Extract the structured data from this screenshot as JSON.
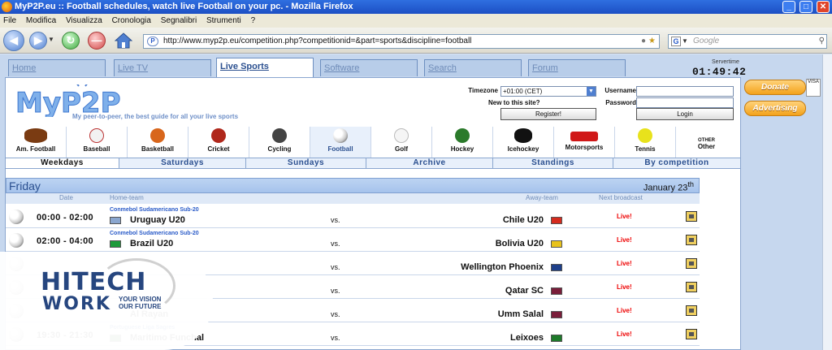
{
  "window": {
    "title": "MyP2P.eu :: Football schedules, watch live Football on your pc. - Mozilla Firefox",
    "min": "_",
    "max": "□",
    "close": "✕"
  },
  "menu": [
    "File",
    "Modifica",
    "Visualizza",
    "Cronologia",
    "Segnalibri",
    "Strumenti",
    "?"
  ],
  "url": "http://www.myp2p.eu/competition.php?competitionid=&part=sports&discipline=football",
  "search_placeholder": "Google",
  "tabs": [
    {
      "label": "Home"
    },
    {
      "label": "Live TV"
    },
    {
      "label": "Live Sports"
    },
    {
      "label": "Software"
    },
    {
      "label": "Search"
    },
    {
      "label": "Forum"
    }
  ],
  "server": {
    "label": "Servertime",
    "time": "01:49:42"
  },
  "logo": {
    "text": "MyP2P",
    "tagline": "My peer-to-peer, the best guide for all your live sports"
  },
  "login": {
    "timezone_label": "Timezone",
    "timezone_value": "+01:00 (CET)",
    "new_label": "New to this site?",
    "register": "Register!",
    "username_label": "Username",
    "password_label": "Password",
    "login": "Login"
  },
  "sports": [
    {
      "label": "Am. Football",
      "color": "#7a3b12"
    },
    {
      "label": "Baseball",
      "color": "#f2f2f2"
    },
    {
      "label": "Basketball",
      "color": "#d8661c"
    },
    {
      "label": "Cricket",
      "color": "#b0281c"
    },
    {
      "label": "Cycling",
      "color": "#444444"
    },
    {
      "label": "Football",
      "color": "#222222"
    },
    {
      "label": "Golf",
      "color": "#f5f5f5"
    },
    {
      "label": "Hockey",
      "color": "#2b7a2b"
    },
    {
      "label": "Icehockey",
      "color": "#111111"
    },
    {
      "label": "Motorsports",
      "color": "#d01818"
    },
    {
      "label": "Tennis",
      "color": "#e8e21c"
    },
    {
      "label": "OTHER",
      "label2": "Other",
      "color": ""
    }
  ],
  "categories": [
    "Weekdays",
    "Saturdays",
    "Sundays",
    "Archive",
    "Standings",
    "By competition"
  ],
  "schedule": {
    "day": "Friday",
    "date": "January 23",
    "date_sup": "th",
    "columns": {
      "date": "Date",
      "home": "Home-team",
      "away": "Away-team",
      "next": "Next broadcast"
    },
    "rows": [
      {
        "time": "00:00 - 02:00",
        "league": "Conmebol Sudamericano Sub-20",
        "home": "Uruguay U20",
        "vs": "vs.",
        "away": "Chile U20",
        "live": "Live!",
        "hflag": "#8aa6cf",
        "aflag": "#d52b1e"
      },
      {
        "time": "02:00 - 04:00",
        "league": "Conmebol Sudamericano Sub-20",
        "home": "Brazil U20",
        "vs": "vs.",
        "away": "Bolivia U20",
        "live": "Live!",
        "hflag": "#1e9a3a",
        "aflag": "#e8c21c"
      },
      {
        "time": "",
        "league": "",
        "home": "",
        "vs": "vs.",
        "away": "Wellington Phoenix",
        "live": "Live!",
        "hflag": "",
        "aflag": "#1e3f8a"
      },
      {
        "time": "",
        "league": "",
        "home": "",
        "vs": "vs.",
        "away": "Qatar SC",
        "live": "Live!",
        "hflag": "",
        "aflag": "#7a1e3a"
      },
      {
        "time": "",
        "league": "",
        "home": "Al Rayan",
        "vs": "vs.",
        "away": "Umm Salal",
        "live": "Live!",
        "hflag": "",
        "aflag": "#7a1e3a"
      },
      {
        "time": "19:30 - 21:30",
        "league": "Portuguese Liga Sagres",
        "home": "Maritimo Funchal",
        "vs": "vs.",
        "away": "Leixoes",
        "live": "Live!",
        "hflag": "#1e7a2a",
        "aflag": "#1e7a2a"
      }
    ]
  },
  "side": {
    "donate": "Donate",
    "advertising": "Advertising",
    "cards": "VISA"
  },
  "watermark": {
    "word1": "HITECH",
    "word2": "WORK",
    "tag": "YOUR VISION OUR FUTURE"
  }
}
